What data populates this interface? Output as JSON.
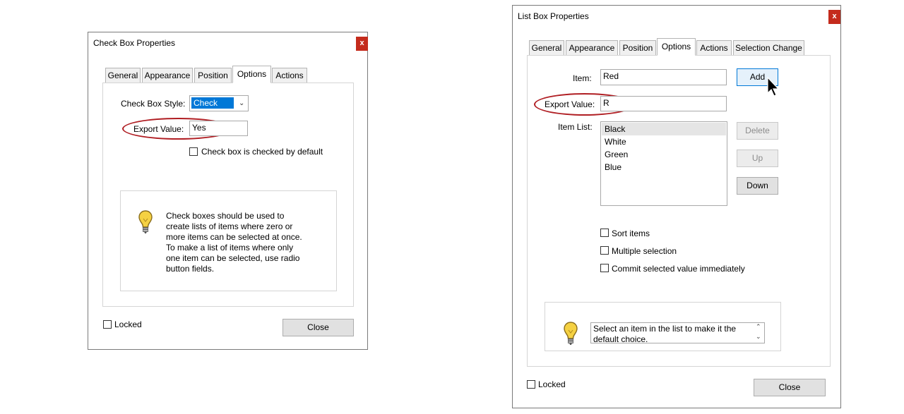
{
  "checkbox_dialog": {
    "title": "Check Box Properties",
    "close": "x",
    "tabs": [
      "General",
      "Appearance",
      "Position",
      "Options",
      "Actions"
    ],
    "active_tab": "Options",
    "style_label": "Check Box Style:",
    "style_value": "Check",
    "export_label": "Export Value:",
    "export_value": "Yes",
    "default_checked_label": "Check box is checked by default",
    "help_text": "Check boxes should be used to create lists of items where zero or more items can be selected at once. To make a list of items where only one item can be selected, use radio button fields.",
    "locked_label": "Locked",
    "close_label": "Close"
  },
  "listbox_dialog": {
    "title": "List Box Properties",
    "close": "x",
    "tabs": [
      "General",
      "Appearance",
      "Position",
      "Options",
      "Actions",
      "Selection Change"
    ],
    "active_tab": "Options",
    "item_label": "Item:",
    "item_value": "Red",
    "add_label": "Add",
    "export_label": "Export Value:",
    "export_value": "R",
    "item_list_label": "Item List:",
    "items": [
      "Black",
      "White",
      "Green",
      "Blue"
    ],
    "selected_item": "Black",
    "delete_label": "Delete",
    "up_label": "Up",
    "down_label": "Down",
    "sort_label": "Sort items",
    "multi_label": "Multiple selection",
    "commit_label": "Commit selected value immediately",
    "help_text": "Select an item in the list to make it the default choice.",
    "locked_label": "Locked",
    "close_label": "Close"
  },
  "colors": {
    "highlight_oval": "#b01e23",
    "close_button": "#c42b1c",
    "selection": "#0078d7"
  }
}
